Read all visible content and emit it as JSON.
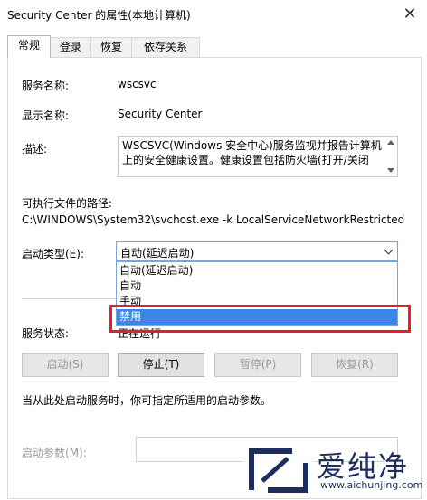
{
  "window": {
    "title": "Security Center 的属性(本地计算机)"
  },
  "tabs": [
    {
      "label": "常规"
    },
    {
      "label": "登录"
    },
    {
      "label": "恢复"
    },
    {
      "label": "依存关系"
    }
  ],
  "general": {
    "service_name_label": "服务名称:",
    "service_name_value": "wscsvc",
    "display_name_label": "显示名称:",
    "display_name_value": "Security Center",
    "description_label": "描述:",
    "description_value": "WSCSVC(Windows 安全中心)服务监视并报告计算机上的安全健康设置。健康设置包括防火墙(打开/关闭",
    "exe_path_label": "可执行文件的路径:",
    "exe_path_value": "C:\\WINDOWS\\System32\\svchost.exe -k LocalServiceNetworkRestricted",
    "startup_type_label": "启动类型(E):",
    "startup_type_value": "自动(延迟启动)",
    "startup_options": [
      "自动(延迟启动)",
      "自动",
      "手动",
      "禁用"
    ],
    "service_status_label": "服务状态:",
    "service_status_value": "正在运行",
    "buttons": {
      "start": "启动(S)",
      "stop": "停止(T)",
      "pause": "暂停(P)",
      "resume": "恢复(R)"
    },
    "hint_text": "当从此处启动服务时，你可指定所适用的启动参数。",
    "start_params_label": "启动参数(M):"
  },
  "watermark": {
    "brand": "爱纯净",
    "url": "www.aichunjing.com"
  }
}
